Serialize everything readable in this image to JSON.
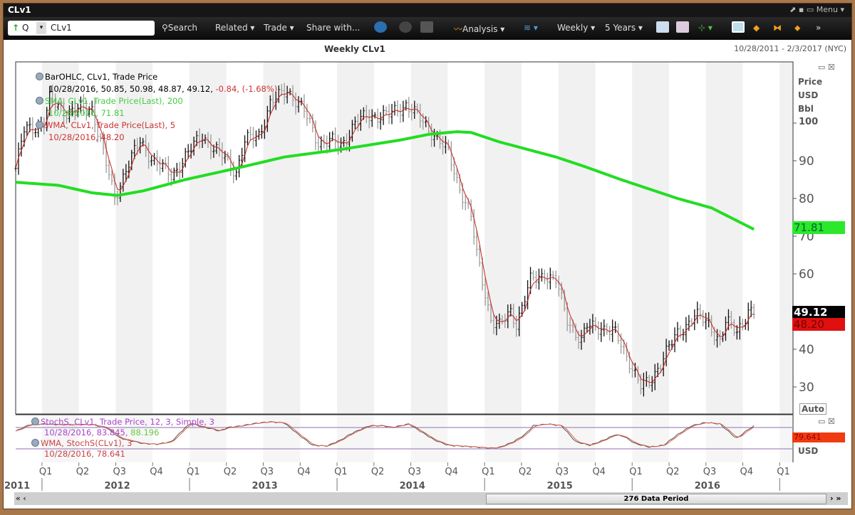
{
  "window": {
    "title": "CLv1",
    "menu_label": "Menu"
  },
  "toolbar": {
    "direction_label": "Q",
    "ric_value": "CLv1",
    "search": "Search",
    "related": "Related ▾",
    "trade": "Trade ▾",
    "share": "Share with...",
    "analysis": "Analysis ▾",
    "interval": "Weekly ▾",
    "range": "5 Years ▾",
    "more": "»"
  },
  "header": {
    "title": "Weekly CLv1",
    "date_range": "10/28/2011 - 2/3/2017 (NYC)"
  },
  "legend": {
    "bar": {
      "name": "BarOHLC, CLv1, Trade Price",
      "values": "10/28/2016, 50.85, 50.98, 48.87, 49.12,",
      "change": "-0.84, (-1.68%)"
    },
    "sma": {
      "name": "SMA, CLv1, Trade Price(Last),  200",
      "values": "10/28/2016, 71.81"
    },
    "wma": {
      "name": "WMA, CLv1, Trade Price(Last),  5",
      "values": "10/28/2016, 48.20"
    },
    "stoch": {
      "name": "StochS, CLv1, Trade Price,  12, 3, Simple, 3",
      "values": "10/28/2016, 83.845,",
      "value2": "88.196"
    },
    "stoch_wma": {
      "name": "WMA, StochS(CLv1),  3",
      "values": "10/28/2016, 78.641"
    }
  },
  "axis": {
    "unit1": "Price",
    "unit2": "USD",
    "unit3": "Bbl",
    "auto": "Auto",
    "stoch_unit": "USD",
    "price_ticks": [
      100,
      90,
      80,
      70,
      60,
      40,
      30
    ],
    "tags": {
      "sma": "71.81",
      "close": "49.12",
      "wma": "48.20",
      "stoch": "79.641"
    },
    "quarters": [
      "Q1",
      "Q2",
      "Q3",
      "Q4",
      "Q1",
      "Q2",
      "Q3",
      "Q4",
      "Q1",
      "Q2",
      "Q3",
      "Q4",
      "Q1",
      "Q2",
      "Q3",
      "Q4",
      "Q1",
      "Q2",
      "Q3",
      "Q4",
      "Q1"
    ],
    "years": [
      "2011",
      "2012",
      "2013",
      "2014",
      "2015",
      "2016"
    ]
  },
  "scrollbar": {
    "label": "276 Data Period"
  },
  "chart_data": {
    "type": "ohlc",
    "title": "Weekly CLv1",
    "x_unit": "weeks since 10/28/2011",
    "ylim": [
      25,
      110
    ],
    "close_anchors": [
      [
        0,
        88
      ],
      [
        3,
        98
      ],
      [
        10,
        100
      ],
      [
        12,
        106
      ],
      [
        18,
        103
      ],
      [
        27,
        104
      ],
      [
        31,
        92
      ],
      [
        35,
        80
      ],
      [
        39,
        88
      ],
      [
        44,
        95
      ],
      [
        49,
        90
      ],
      [
        55,
        86
      ],
      [
        62,
        93
      ],
      [
        66,
        97
      ],
      [
        70,
        93
      ],
      [
        75,
        90
      ],
      [
        78,
        87
      ],
      [
        81,
        95
      ],
      [
        86,
        97
      ],
      [
        90,
        105
      ],
      [
        96,
        109
      ],
      [
        102,
        103
      ],
      [
        107,
        95
      ],
      [
        112,
        95
      ],
      [
        115,
        94
      ],
      [
        120,
        100
      ],
      [
        125,
        102
      ],
      [
        132,
        102
      ],
      [
        138,
        105
      ],
      [
        143,
        101
      ],
      [
        148,
        97
      ],
      [
        153,
        92
      ],
      [
        156,
        85
      ],
      [
        161,
        75
      ],
      [
        163,
        65
      ],
      [
        166,
        55
      ],
      [
        168,
        48
      ],
      [
        171,
        46
      ],
      [
        175,
        50
      ],
      [
        177,
        47
      ],
      [
        182,
        58
      ],
      [
        187,
        60
      ],
      [
        191,
        58
      ],
      [
        195,
        48
      ],
      [
        200,
        42
      ],
      [
        202,
        46
      ],
      [
        207,
        46
      ],
      [
        212,
        44
      ],
      [
        217,
        37
      ],
      [
        221,
        30
      ],
      [
        224,
        31
      ],
      [
        229,
        38
      ],
      [
        234,
        44
      ],
      [
        240,
        49
      ],
      [
        245,
        47
      ],
      [
        249,
        42
      ],
      [
        251,
        47
      ],
      [
        255,
        45
      ],
      [
        259,
        50
      ],
      [
        261,
        49.12
      ]
    ],
    "sma200": [
      [
        0,
        84.3
      ],
      [
        15,
        83.5
      ],
      [
        27,
        81.5
      ],
      [
        36,
        80.8
      ],
      [
        45,
        82
      ],
      [
        60,
        85
      ],
      [
        78,
        88
      ],
      [
        95,
        91
      ],
      [
        115,
        93
      ],
      [
        136,
        95.5
      ],
      [
        146,
        97
      ],
      [
        156,
        97.7
      ],
      [
        161,
        97.5
      ],
      [
        171,
        95
      ],
      [
        191,
        91
      ],
      [
        201,
        88.5
      ],
      [
        214,
        85
      ],
      [
        234,
        80
      ],
      [
        246,
        77.5
      ],
      [
        261,
        71.81
      ]
    ],
    "stoch": [
      [
        0,
        70
      ],
      [
        5,
        88
      ],
      [
        10,
        90
      ],
      [
        15,
        88
      ],
      [
        27,
        88
      ],
      [
        32,
        80
      ],
      [
        37,
        50
      ],
      [
        45,
        35
      ],
      [
        50,
        33
      ],
      [
        55,
        40
      ],
      [
        60,
        80
      ],
      [
        62,
        92
      ],
      [
        66,
        82
      ],
      [
        70,
        75
      ],
      [
        72,
        70
      ],
      [
        75,
        80
      ],
      [
        80,
        85
      ],
      [
        85,
        92
      ],
      [
        90,
        96
      ],
      [
        95,
        93
      ],
      [
        100,
        60
      ],
      [
        105,
        30
      ],
      [
        110,
        28
      ],
      [
        115,
        45
      ],
      [
        118,
        60
      ],
      [
        120,
        68
      ],
      [
        125,
        85
      ],
      [
        130,
        85
      ],
      [
        133,
        80
      ],
      [
        136,
        85
      ],
      [
        139,
        90
      ],
      [
        143,
        70
      ],
      [
        148,
        45
      ],
      [
        153,
        30
      ],
      [
        161,
        26
      ],
      [
        168,
        22
      ],
      [
        171,
        24
      ],
      [
        176,
        40
      ],
      [
        180,
        60
      ],
      [
        183,
        85
      ],
      [
        188,
        90
      ],
      [
        193,
        85
      ],
      [
        198,
        40
      ],
      [
        203,
        30
      ],
      [
        208,
        45
      ],
      [
        212,
        60
      ],
      [
        215,
        55
      ],
      [
        219,
        35
      ],
      [
        224,
        25
      ],
      [
        229,
        30
      ],
      [
        234,
        60
      ],
      [
        239,
        85
      ],
      [
        244,
        94
      ],
      [
        249,
        90
      ],
      [
        254,
        55
      ],
      [
        255,
        50
      ],
      [
        259,
        75
      ],
      [
        261,
        83.8
      ]
    ],
    "stoch_levels": [
      80,
      20
    ]
  }
}
